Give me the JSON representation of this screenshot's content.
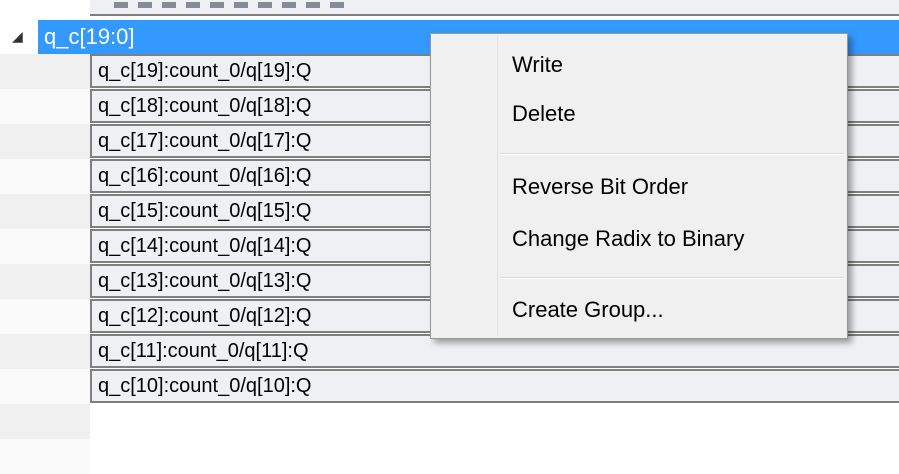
{
  "tree": {
    "group": {
      "expander_icon": "triangle-down",
      "label": "q_c[19:0]",
      "selected_color": "#3399ff"
    },
    "rows": [
      {
        "label": "q_c[19]:count_0/q[19]:Q"
      },
      {
        "label": "q_c[18]:count_0/q[18]:Q"
      },
      {
        "label": "q_c[17]:count_0/q[17]:Q"
      },
      {
        "label": "q_c[16]:count_0/q[16]:Q"
      },
      {
        "label": "q_c[15]:count_0/q[15]:Q"
      },
      {
        "label": "q_c[14]:count_0/q[14]:Q"
      },
      {
        "label": "q_c[13]:count_0/q[13]:Q"
      },
      {
        "label": "q_c[12]:count_0/q[12]:Q"
      },
      {
        "label": "q_c[11]:count_0/q[11]:Q"
      },
      {
        "label": "q_c[10]:count_0/q[10]:Q"
      }
    ]
  },
  "context_menu": {
    "items": [
      {
        "label": "Write"
      },
      {
        "label": "Delete"
      },
      {
        "label": "Reverse Bit Order"
      },
      {
        "label": "Change Radix to Binary"
      },
      {
        "label": "Create Group..."
      }
    ]
  }
}
